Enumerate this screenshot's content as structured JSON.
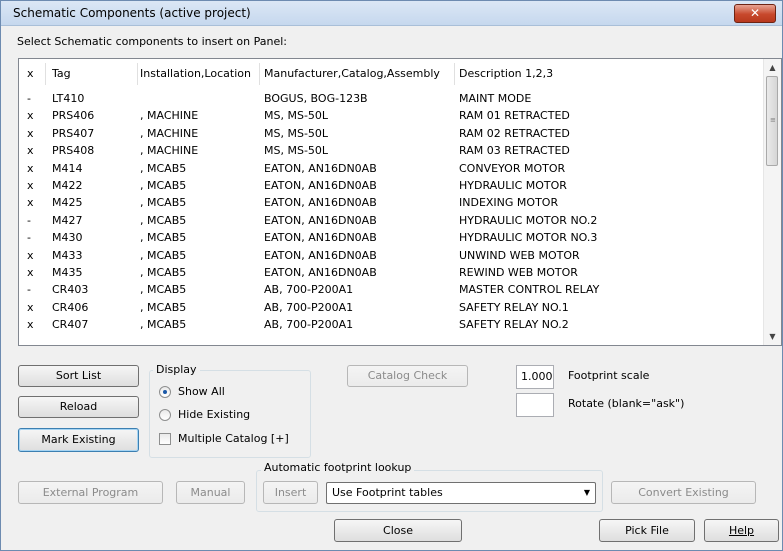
{
  "window": {
    "title": "Schematic Components (active project)",
    "close_label": "✕",
    "prompt": "Select Schematic components to insert on Panel:"
  },
  "list": {
    "columns": [
      "x",
      "Tag",
      "Installation,Location",
      "Manufacturer,Catalog,Assembly",
      "Description 1,2,3"
    ],
    "rows": [
      {
        "mark": "-",
        "tag": "LT410",
        "loc": "",
        "mfr": "BOGUS, BOG-123B",
        "desc": "MAINT MODE"
      },
      {
        "mark": "x",
        "tag": "PRS406",
        "loc": ", MACHINE",
        "mfr": "MS, MS-50L",
        "desc": "RAM 01 RETRACTED"
      },
      {
        "mark": "x",
        "tag": "PRS407",
        "loc": ", MACHINE",
        "mfr": "MS, MS-50L",
        "desc": "RAM 02 RETRACTED"
      },
      {
        "mark": "x",
        "tag": "PRS408",
        "loc": ", MACHINE",
        "mfr": "MS, MS-50L",
        "desc": "RAM 03 RETRACTED"
      },
      {
        "mark": "x",
        "tag": "M414",
        "loc": ", MCAB5",
        "mfr": "EATON, AN16DN0AB",
        "desc": "CONVEYOR MOTOR"
      },
      {
        "mark": "x",
        "tag": "M422",
        "loc": ", MCAB5",
        "mfr": "EATON, AN16DN0AB",
        "desc": "HYDRAULIC MOTOR"
      },
      {
        "mark": "x",
        "tag": "M425",
        "loc": ", MCAB5",
        "mfr": "EATON, AN16DN0AB",
        "desc": "INDEXING MOTOR"
      },
      {
        "mark": "-",
        "tag": "M427",
        "loc": ", MCAB5",
        "mfr": "EATON, AN16DN0AB",
        "desc": "HYDRAULIC MOTOR NO.2"
      },
      {
        "mark": "-",
        "tag": "M430",
        "loc": ", MCAB5",
        "mfr": "EATON, AN16DN0AB",
        "desc": "HYDRAULIC MOTOR NO.3"
      },
      {
        "mark": "x",
        "tag": "M433",
        "loc": ", MCAB5",
        "mfr": "EATON, AN16DN0AB",
        "desc": "UNWIND WEB MOTOR"
      },
      {
        "mark": "x",
        "tag": "M435",
        "loc": ", MCAB5",
        "mfr": "EATON, AN16DN0AB",
        "desc": "REWIND WEB MOTOR"
      },
      {
        "mark": "-",
        "tag": "CR403",
        "loc": ", MCAB5",
        "mfr": "AB, 700-P200A1",
        "desc": "MASTER CONTROL RELAY"
      },
      {
        "mark": "x",
        "tag": "CR406",
        "loc": ", MCAB5",
        "mfr": "AB, 700-P200A1",
        "desc": "SAFETY RELAY NO.1"
      },
      {
        "mark": "x",
        "tag": "CR407",
        "loc": ", MCAB5",
        "mfr": "AB, 700-P200A1",
        "desc": "SAFETY RELAY NO.2"
      }
    ]
  },
  "buttons": {
    "sort_list": "Sort List",
    "reload": "Reload",
    "mark_existing": "Mark Existing",
    "catalog_check": "Catalog Check",
    "external_program": "External Program",
    "manual": "Manual",
    "insert": "Insert",
    "convert_existing": "Convert Existing",
    "close": "Close",
    "pick_file": "Pick File",
    "help": "Help"
  },
  "display": {
    "legend": "Display",
    "show_all": "Show All",
    "hide_existing": "Hide Existing",
    "multiple_catalog": "Multiple Catalog [+]",
    "selected": "show_all",
    "multiple_catalog_checked": false
  },
  "footprint": {
    "scale_value": "1.000",
    "scale_label": "Footprint scale",
    "rotate_value": "",
    "rotate_label": "Rotate (blank=\"ask\")",
    "lookup_legend": "Automatic footprint lookup",
    "lookup_selected": "Use Footprint tables"
  }
}
